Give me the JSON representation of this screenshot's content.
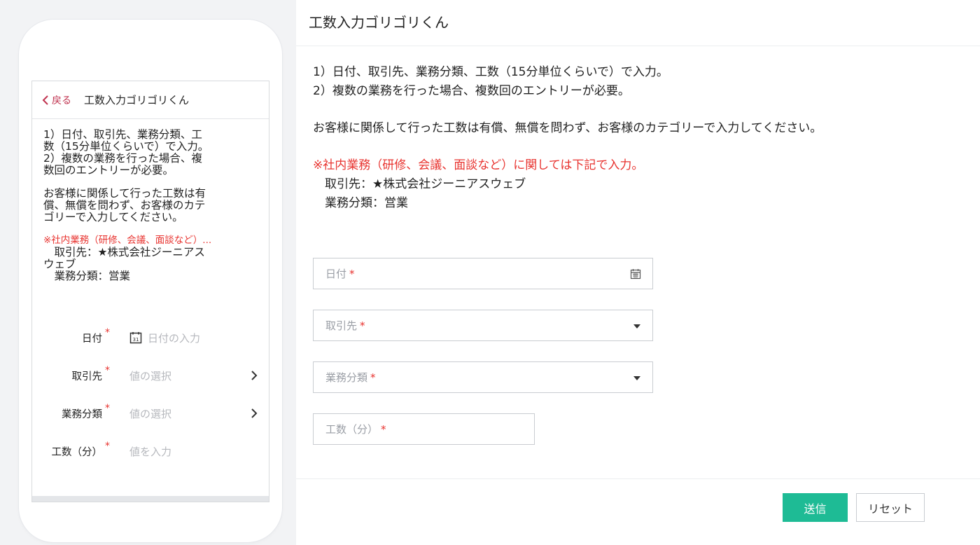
{
  "app_title": "工数入力ゴリゴリくん",
  "mobile": {
    "back_label": "戻る",
    "title": "工数入力ゴリゴリくん",
    "instructions": [
      "1）日付、取引先、業務分類、工",
      "数（15分単位くらいで）で入力。",
      "2）複数の業務を行った場合、複",
      "数回のエントリーが必要。"
    ],
    "note": [
      "お客様に関係して行った工数は有",
      "償、無償を問わず、お客様のカテ",
      "ゴリーで入力してください。"
    ],
    "internal_title": "※社内業務（研修、会議、面談など）...",
    "internal_lines": [
      "　取引先：★株式会社ジーニアス",
      "ウェブ",
      "　業務分類：営業"
    ],
    "fields": [
      {
        "label": "日付",
        "value": "日付の入力",
        "icon": "calendar-icon"
      },
      {
        "label": "取引先",
        "value": "値の選択",
        "icon": "chevron-right-icon"
      },
      {
        "label": "業務分類",
        "value": "値の選択",
        "icon": "chevron-right-icon"
      },
      {
        "label": "工数（分）",
        "value": "値を入力"
      }
    ],
    "required_mark": "*"
  },
  "desktop": {
    "instructions": [
      "1）日付、取引先、業務分類、工数（15分単位くらいで）で入力。",
      "2）複数の業務を行った場合、複数回のエントリーが必要。"
    ],
    "note": "お客様に関係して行った工数は有償、無償を問わず、お客様のカテゴリーで入力してください。",
    "internal_title": "※社内業務（研修、会議、面談など）に関しては下記で入力。",
    "internal_lines": [
      "　取引先：★株式会社ジーニアスウェブ",
      "　業務分類：営業"
    ],
    "fields": [
      {
        "placeholder": "日付",
        "icon": "calendar-icon"
      },
      {
        "placeholder": "取引先",
        "icon": "caret-down-icon"
      },
      {
        "placeholder": "業務分類",
        "icon": "caret-down-icon"
      },
      {
        "placeholder": "工数（分）"
      }
    ],
    "required_mark": "*",
    "submit_label": "送信",
    "reset_label": "リセット"
  },
  "colors": {
    "accent": "#1ebb95",
    "required": "#e8332f",
    "back_link": "#c0334f"
  }
}
